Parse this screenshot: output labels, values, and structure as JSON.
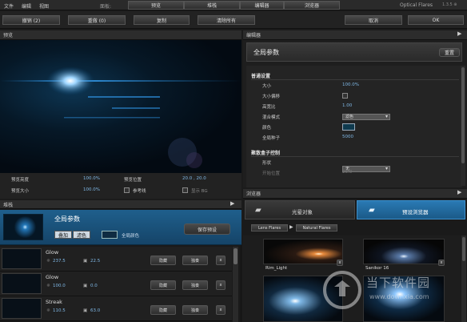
{
  "menu": {
    "items": [
      "文件",
      "编辑",
      "视图"
    ],
    "scene_label": "面板:",
    "tabs": [
      "预览",
      "堆栈",
      "编辑器",
      "浏览器"
    ],
    "brand": "Optical Flares",
    "version": "1.3.5 ⊕"
  },
  "toolbar": {
    "undo": "撤销 (2)",
    "redo": "重做 (0)",
    "copy": "复制",
    "clear_all": "清除所有",
    "cancel": "取消",
    "ok": "OK"
  },
  "preview": {
    "title": "预览",
    "rows": [
      {
        "label": "预览亮度",
        "value": "100.0%",
        "label2": "预览位置",
        "value2": "20.0 , 20.0"
      },
      {
        "label": "预览大小",
        "value": "100.0%",
        "label2": "参考线",
        "value2": "显示 BG"
      }
    ]
  },
  "stack": {
    "title": "堆栈",
    "global": {
      "title": "全局参数",
      "tag1": "叠加",
      "tag2": "滤色",
      "color_label": "全局颜色",
      "save_preset": "保存预设"
    },
    "items": [
      {
        "name": "Glow",
        "brightness": "237.5",
        "scale": "22.5"
      },
      {
        "name": "Glow",
        "brightness": "100.0",
        "scale": "0.0"
      },
      {
        "name": "Streak",
        "brightness": "110.5",
        "scale": "63.0"
      }
    ],
    "hide_label": "隐藏",
    "solo_label": "独奏",
    "remove_label": "x"
  },
  "editor": {
    "title": "编辑器",
    "header": "全局参数",
    "reset": "重置",
    "section1": "普通设置",
    "rows": [
      {
        "label": "大小",
        "type": "value",
        "value": "100.0%"
      },
      {
        "label": "大小偏移",
        "type": "check"
      },
      {
        "label": "高宽比",
        "type": "value",
        "value": "1.00"
      },
      {
        "label": "混合模式",
        "type": "select",
        "value": "滤色"
      },
      {
        "label": "颜色",
        "type": "swatch"
      },
      {
        "label": "全局种子",
        "type": "value",
        "value": "5000"
      }
    ],
    "section2": "聚散盒子控制",
    "rows2": [
      {
        "label": "形状",
        "type": "select",
        "value": "无"
      },
      {
        "label": "开始位置",
        "type": "value",
        "value": "25.0"
      }
    ]
  },
  "browser": {
    "title": "浏览器",
    "tab1": "光晕对象",
    "tab2": "预设浏览器",
    "crumb1": "Lens Flares",
    "crumb2": "Natural Flares",
    "items": [
      {
        "name": "Rim_Light"
      },
      {
        "name": "Sanikor 16"
      },
      {
        "name": ""
      },
      {
        "name": ""
      }
    ]
  },
  "watermark": {
    "title": "当下软件园",
    "url": "www.downxia.com"
  },
  "colors": {
    "accent": "#1e5f8a",
    "highlight": "#7fb8e6",
    "bg": "#1b1b1b"
  }
}
